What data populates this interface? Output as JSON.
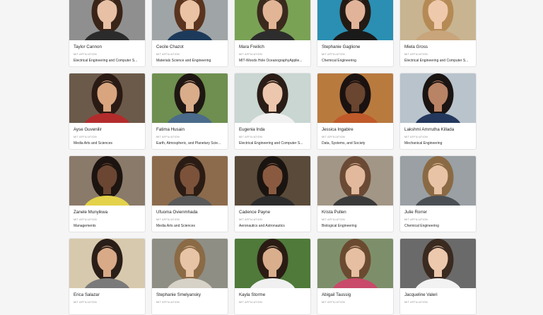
{
  "affiliation_label": "MIT AFFILIATION",
  "people": [
    {
      "name": "Taylor Cannon",
      "affiliation": "Electrical Engineering and Computer S...",
      "bg": "#8f8f8f",
      "hair": "#3a2418",
      "skin": "#e7c0a6",
      "top": "#2b2b2b"
    },
    {
      "name": "Cecile Chazot",
      "affiliation": "Materials Science and Engineering",
      "bg": "#9fa4a6",
      "hair": "#5a341e",
      "skin": "#e9c3a3",
      "top": "#1d3a5b"
    },
    {
      "name": "Mara Freilich",
      "affiliation": "MIT-Woods Hole OceanographyApplie...",
      "bg": "#7aa255",
      "hair": "#3a2a1e",
      "skin": "#e2b596",
      "top": "#2d2d2d"
    },
    {
      "name": "Stephanie Gaglione",
      "affiliation": "Chemical Engineering",
      "bg": "#2a8fb3",
      "hair": "#241a14",
      "skin": "#e1b49a",
      "top": "#1a1a1a"
    },
    {
      "name": "Miela Gross",
      "affiliation": "Electrical Engineering and Computer S...",
      "bg": "#c8b490",
      "hair": "#b58a55",
      "skin": "#efc9ab",
      "top": "#c9a57c"
    },
    {
      "name": "Ayse Guvenilir",
      "affiliation": "Media Arts and Sciences",
      "bg": "#6b5a4a",
      "hair": "#2a1a14",
      "skin": "#d8a57f",
      "top": "#b32c2c"
    },
    {
      "name": "Fatima Husain",
      "affiliation": "Earth, Atmospheric, and Planetary Scie...",
      "bg": "#6e8f4f",
      "hair": "#1e1612",
      "skin": "#d9ac8a",
      "top": "#4b6b8a"
    },
    {
      "name": "Eugenia Inda",
      "affiliation": "Electrical Engineering and Computer S...",
      "bg": "#c9d6d2",
      "hair": "#2a1c16",
      "skin": "#ecc6ad",
      "top": "#f1f1f1"
    },
    {
      "name": "Jessica Ingabire",
      "affiliation": "Data, Systems, and Society",
      "bg": "#b97a3e",
      "hair": "#1a1210",
      "skin": "#6a4530",
      "top": "#c05a2a"
    },
    {
      "name": "Lakshmi Amrrutha Killada",
      "affiliation": "Mechanical Engineering",
      "bg": "#b8c3cc",
      "hair": "#1a1412",
      "skin": "#b98365",
      "top": "#24385e"
    },
    {
      "name": "Zanele Munyikwa",
      "affiliation": "Managements",
      "bg": "#8a7a6a",
      "hair": "#1c1410",
      "skin": "#6b4632",
      "top": "#e3d24a"
    },
    {
      "name": "Ufuoma Ovienmhada",
      "affiliation": "Media Arts and Sciences",
      "bg": "#8c6b4c",
      "hair": "#2a1c14",
      "skin": "#7c523a",
      "top": "#595959"
    },
    {
      "name": "Cadence Payne",
      "affiliation": "Aeronautics and Astronautics",
      "bg": "#5a4a3a",
      "hair": "#1a1410",
      "skin": "#8a5a40",
      "top": "#2c2c2c"
    },
    {
      "name": "Krista Pullen",
      "affiliation": "Biological Engineering",
      "bg": "#a29686",
      "hair": "#6a4a34",
      "skin": "#e2b99c",
      "top": "#3a3a3a"
    },
    {
      "name": "Julie Rorrer",
      "affiliation": "Chemical Engineering",
      "bg": "#9aa0a4",
      "hair": "#8a6a44",
      "skin": "#e8c3a5",
      "top": "#4a4f54"
    },
    {
      "name": "Erica Salazar",
      "affiliation": "",
      "bg": "#d7c9ad",
      "hair": "#2a1e18",
      "skin": "#d8aa88",
      "top": "#7a7a7a"
    },
    {
      "name": "Stephanie Smelyansky",
      "affiliation": "",
      "bg": "#8e8e84",
      "hair": "#8b6a46",
      "skin": "#e8c4a6",
      "top": "#d7d2c8"
    },
    {
      "name": "Kayla Storme",
      "affiliation": "",
      "bg": "#4f7a3a",
      "hair": "#2a1c14",
      "skin": "#d9ae8d",
      "top": "#f0f0f0"
    },
    {
      "name": "Abigail Taussig",
      "affiliation": "",
      "bg": "#7d8f6a",
      "hair": "#6a4a30",
      "skin": "#e6bfa2",
      "top": "#c94a6a"
    },
    {
      "name": "Jacqueline Valeri",
      "affiliation": "",
      "bg": "#6a6a6a",
      "hair": "#3a2a20",
      "skin": "#ecc8ad",
      "top": "#f2f2f2"
    }
  ]
}
